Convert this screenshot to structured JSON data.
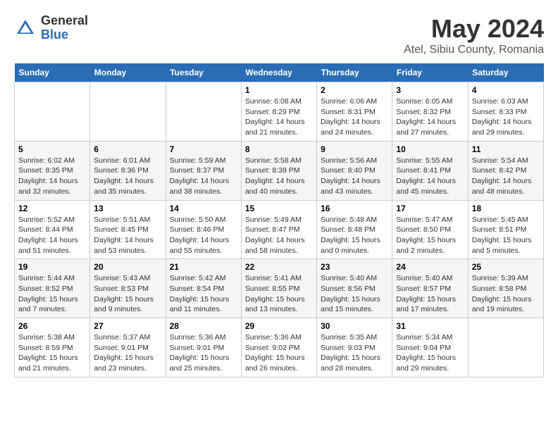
{
  "header": {
    "logo": {
      "general": "General",
      "blue": "Blue"
    },
    "title": "May 2024",
    "location": "Atel, Sibiu County, Romania"
  },
  "calendar": {
    "days_of_week": [
      "Sunday",
      "Monday",
      "Tuesday",
      "Wednesday",
      "Thursday",
      "Friday",
      "Saturday"
    ],
    "weeks": [
      [
        {
          "day": "",
          "info": ""
        },
        {
          "day": "",
          "info": ""
        },
        {
          "day": "",
          "info": ""
        },
        {
          "day": "1",
          "info": "Sunrise: 6:08 AM\nSunset: 8:29 PM\nDaylight: 14 hours\nand 21 minutes."
        },
        {
          "day": "2",
          "info": "Sunrise: 6:06 AM\nSunset: 8:31 PM\nDaylight: 14 hours\nand 24 minutes."
        },
        {
          "day": "3",
          "info": "Sunrise: 6:05 AM\nSunset: 8:32 PM\nDaylight: 14 hours\nand 27 minutes."
        },
        {
          "day": "4",
          "info": "Sunrise: 6:03 AM\nSunset: 8:33 PM\nDaylight: 14 hours\nand 29 minutes."
        }
      ],
      [
        {
          "day": "5",
          "info": "Sunrise: 6:02 AM\nSunset: 8:35 PM\nDaylight: 14 hours\nand 32 minutes."
        },
        {
          "day": "6",
          "info": "Sunrise: 6:01 AM\nSunset: 8:36 PM\nDaylight: 14 hours\nand 35 minutes."
        },
        {
          "day": "7",
          "info": "Sunrise: 5:59 AM\nSunset: 8:37 PM\nDaylight: 14 hours\nand 38 minutes."
        },
        {
          "day": "8",
          "info": "Sunrise: 5:58 AM\nSunset: 8:39 PM\nDaylight: 14 hours\nand 40 minutes."
        },
        {
          "day": "9",
          "info": "Sunrise: 5:56 AM\nSunset: 8:40 PM\nDaylight: 14 hours\nand 43 minutes."
        },
        {
          "day": "10",
          "info": "Sunrise: 5:55 AM\nSunset: 8:41 PM\nDaylight: 14 hours\nand 45 minutes."
        },
        {
          "day": "11",
          "info": "Sunrise: 5:54 AM\nSunset: 8:42 PM\nDaylight: 14 hours\nand 48 minutes."
        }
      ],
      [
        {
          "day": "12",
          "info": "Sunrise: 5:52 AM\nSunset: 8:44 PM\nDaylight: 14 hours\nand 51 minutes."
        },
        {
          "day": "13",
          "info": "Sunrise: 5:51 AM\nSunset: 8:45 PM\nDaylight: 14 hours\nand 53 minutes."
        },
        {
          "day": "14",
          "info": "Sunrise: 5:50 AM\nSunset: 8:46 PM\nDaylight: 14 hours\nand 55 minutes."
        },
        {
          "day": "15",
          "info": "Sunrise: 5:49 AM\nSunset: 8:47 PM\nDaylight: 14 hours\nand 58 minutes."
        },
        {
          "day": "16",
          "info": "Sunrise: 5:48 AM\nSunset: 8:48 PM\nDaylight: 15 hours\nand 0 minutes."
        },
        {
          "day": "17",
          "info": "Sunrise: 5:47 AM\nSunset: 8:50 PM\nDaylight: 15 hours\nand 2 minutes."
        },
        {
          "day": "18",
          "info": "Sunrise: 5:45 AM\nSunset: 8:51 PM\nDaylight: 15 hours\nand 5 minutes."
        }
      ],
      [
        {
          "day": "19",
          "info": "Sunrise: 5:44 AM\nSunset: 8:52 PM\nDaylight: 15 hours\nand 7 minutes."
        },
        {
          "day": "20",
          "info": "Sunrise: 5:43 AM\nSunset: 8:53 PM\nDaylight: 15 hours\nand 9 minutes."
        },
        {
          "day": "21",
          "info": "Sunrise: 5:42 AM\nSunset: 8:54 PM\nDaylight: 15 hours\nand 11 minutes."
        },
        {
          "day": "22",
          "info": "Sunrise: 5:41 AM\nSunset: 8:55 PM\nDaylight: 15 hours\nand 13 minutes."
        },
        {
          "day": "23",
          "info": "Sunrise: 5:40 AM\nSunset: 8:56 PM\nDaylight: 15 hours\nand 15 minutes."
        },
        {
          "day": "24",
          "info": "Sunrise: 5:40 AM\nSunset: 8:57 PM\nDaylight: 15 hours\nand 17 minutes."
        },
        {
          "day": "25",
          "info": "Sunrise: 5:39 AM\nSunset: 8:58 PM\nDaylight: 15 hours\nand 19 minutes."
        }
      ],
      [
        {
          "day": "26",
          "info": "Sunrise: 5:38 AM\nSunset: 8:59 PM\nDaylight: 15 hours\nand 21 minutes."
        },
        {
          "day": "27",
          "info": "Sunrise: 5:37 AM\nSunset: 9:01 PM\nDaylight: 15 hours\nand 23 minutes."
        },
        {
          "day": "28",
          "info": "Sunrise: 5:36 AM\nSunset: 9:01 PM\nDaylight: 15 hours\nand 25 minutes."
        },
        {
          "day": "29",
          "info": "Sunrise: 5:36 AM\nSunset: 9:02 PM\nDaylight: 15 hours\nand 26 minutes."
        },
        {
          "day": "30",
          "info": "Sunrise: 5:35 AM\nSunset: 9:03 PM\nDaylight: 15 hours\nand 28 minutes."
        },
        {
          "day": "31",
          "info": "Sunrise: 5:34 AM\nSunset: 9:04 PM\nDaylight: 15 hours\nand 29 minutes."
        },
        {
          "day": "",
          "info": ""
        }
      ]
    ]
  }
}
